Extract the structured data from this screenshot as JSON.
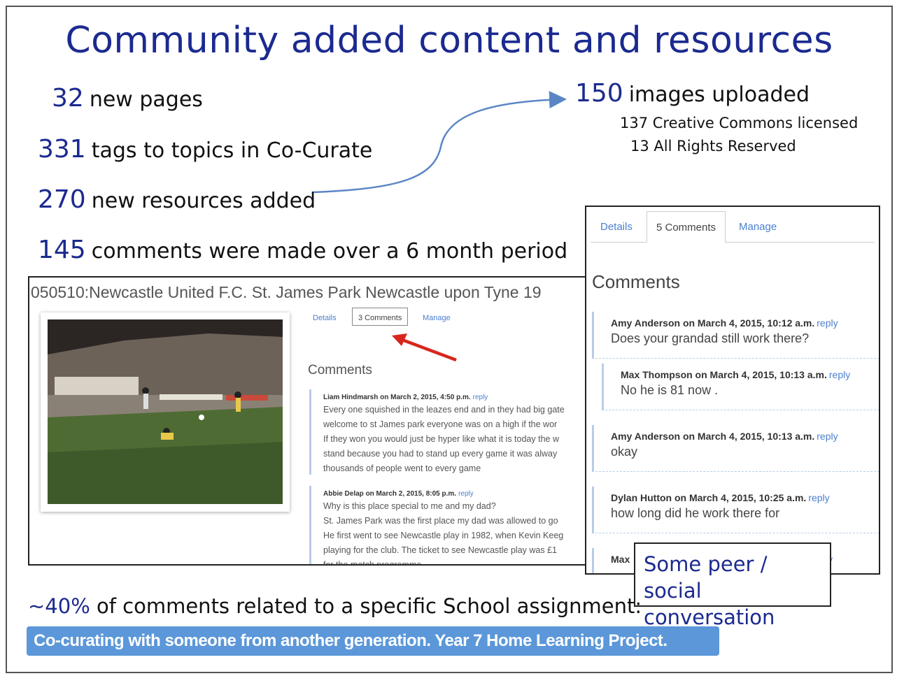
{
  "title": "Community added content and resources",
  "stats": [
    {
      "num": "32",
      "text": "new pages"
    },
    {
      "num": "331",
      "text": "tags to topics in Co-Curate"
    },
    {
      "num": "270",
      "text": "new resources added"
    },
    {
      "num": "145",
      "text": "comments were made over a 6 month period"
    }
  ],
  "images": {
    "num": "150",
    "text": "images uploaded",
    "cc": "137 Creative Commons licensed",
    "arr": "13 All Rights Reserved"
  },
  "screenshot1": {
    "heading": "050510:Newcastle United F.C. St. James Park Newcastle upon Tyne 19",
    "tabs": {
      "details": "Details",
      "comments": "3 Comments",
      "manage": "Manage"
    },
    "comments_heading": "Comments",
    "comments": [
      {
        "author": "Liam Hindmarsh on March 2, 2015, 4:50 p.m.",
        "reply": "reply",
        "lines": [
          "Every one squished in the leazes end and in they had big gate",
          "welcome to st James park everyone was on a high if the wor",
          "If they won you would just be hyper like what it is today the w",
          "stand because you had to stand up every game it was alway",
          "thousands of people went to every game"
        ]
      },
      {
        "author": "Abbie Delap on March 2, 2015, 8:05 p.m.",
        "reply": "reply",
        "lines": [
          "Why is this place special to me and my dad?",
          "St. James Park was the first place my dad was allowed to go",
          "He first went to see Newcastle play in 1982, when Kevin Keeg",
          "playing for the club. The ticket to see Newcastle play was £1",
          "for the match programme."
        ]
      }
    ]
  },
  "screenshot2": {
    "tabs": {
      "details": "Details",
      "comments": "5 Comments",
      "manage": "Manage"
    },
    "comments_heading": "Comments",
    "comments": [
      {
        "author": "Amy Anderson on March 4, 2015, 10:12 a.m.",
        "reply": "reply",
        "text": "Does your grandad still work there?"
      },
      {
        "author": "Max Thompson on March 4, 2015, 10:13 a.m.",
        "reply": "reply",
        "text": "No he is 81 now ."
      },
      {
        "author": "Amy Anderson on March 4, 2015, 10:13 a.m.",
        "reply": "reply",
        "text": "okay"
      },
      {
        "author": "Dylan Hutton on March 4, 2015, 10:25 a.m.",
        "reply": "reply",
        "text": "how long did he work there for"
      },
      {
        "author": "Max",
        "reply": "ply",
        "text": ""
      }
    ]
  },
  "callout": {
    "line1": "Some peer /",
    "line2": "social conversation"
  },
  "bottom": {
    "pct": "~40%",
    "text": "of comments related to a specific School assignment:",
    "highlight": "Co-curating with someone from another generation. Year 7 Home Learning Project."
  },
  "colors": {
    "heading_blue": "#1b2a8f",
    "highlight_blue": "#5b97d9",
    "link_blue": "#4a7fd0",
    "arrow_blue": "#5a86c5",
    "red_arrow": "#d8261d"
  }
}
